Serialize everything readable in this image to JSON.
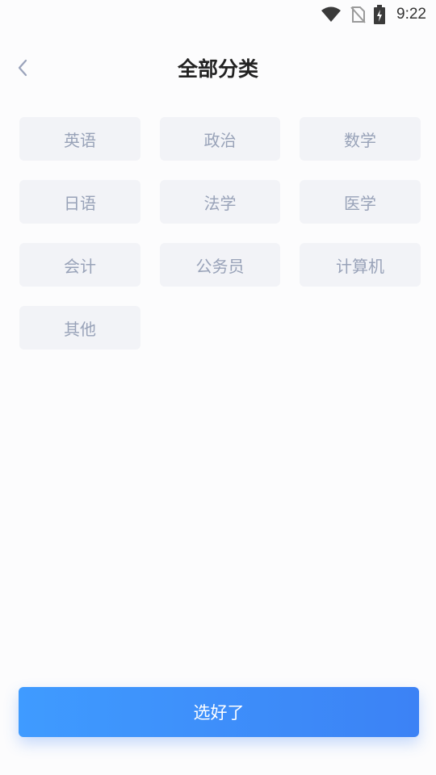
{
  "status_bar": {
    "time": "9:22",
    "icons": [
      "wifi-icon",
      "no-sim-icon",
      "battery-charging-icon"
    ]
  },
  "header": {
    "title": "全部分类",
    "back_icon": "chevron-left-icon"
  },
  "categories": [
    {
      "label": "英语"
    },
    {
      "label": "政治"
    },
    {
      "label": "数学"
    },
    {
      "label": "日语"
    },
    {
      "label": "法学"
    },
    {
      "label": "医学"
    },
    {
      "label": "会计"
    },
    {
      "label": "公务员"
    },
    {
      "label": "计算机"
    },
    {
      "label": "其他"
    }
  ],
  "confirm_button": {
    "label": "选好了"
  },
  "colors": {
    "accent_start": "#3f9bff",
    "accent_end": "#3c82f5",
    "chip_bg": "#f2f3f7",
    "chip_text": "#98a2b8"
  }
}
